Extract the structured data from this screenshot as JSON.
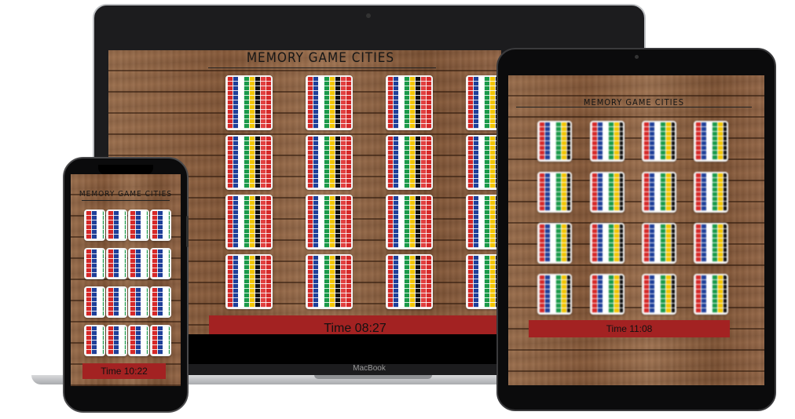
{
  "laptop": {
    "game_title": "MEMORY GAME CITIES",
    "timer_label": "Time 08:27",
    "brand_label": "MacBook"
  },
  "tablet": {
    "game_title": "MEMORY GAME CITIES",
    "timer_label": "Time 11:08"
  },
  "phone": {
    "game_title": "MEMORY GAME CITIES",
    "timer_label": "Time 10:22"
  },
  "card_back": "world-flags-collage"
}
